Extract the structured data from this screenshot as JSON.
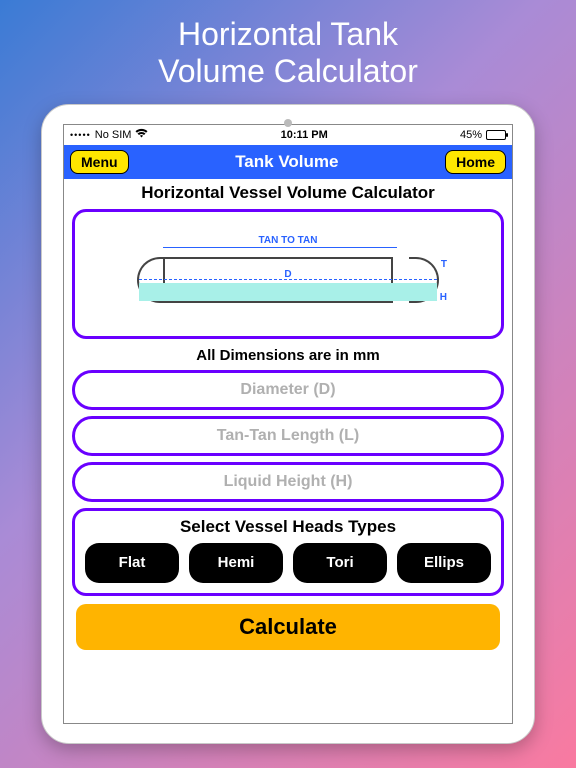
{
  "hero": {
    "line1": "Horizontal Tank",
    "line2": "Volume Calculator"
  },
  "status": {
    "carrier": "No SIM",
    "time": "10:11 PM",
    "battery": "45%"
  },
  "nav": {
    "menu": "Menu",
    "title": "Tank Volume",
    "home": "Home"
  },
  "header": "Horizontal Vessel Volume Calculator",
  "diagram": {
    "tan": "TAN TO TAN",
    "d": "D",
    "h": "H",
    "t": "T"
  },
  "dims_note": "All Dimensions are in mm",
  "inputs": {
    "diameter": "Diameter (D)",
    "length": "Tan-Tan Length (L)",
    "height": "Liquid Height (H)"
  },
  "heads": {
    "title": "Select Vessel Heads Types",
    "options": [
      "Flat",
      "Hemi",
      "Tori",
      "Ellips"
    ]
  },
  "calculate": "Calculate"
}
